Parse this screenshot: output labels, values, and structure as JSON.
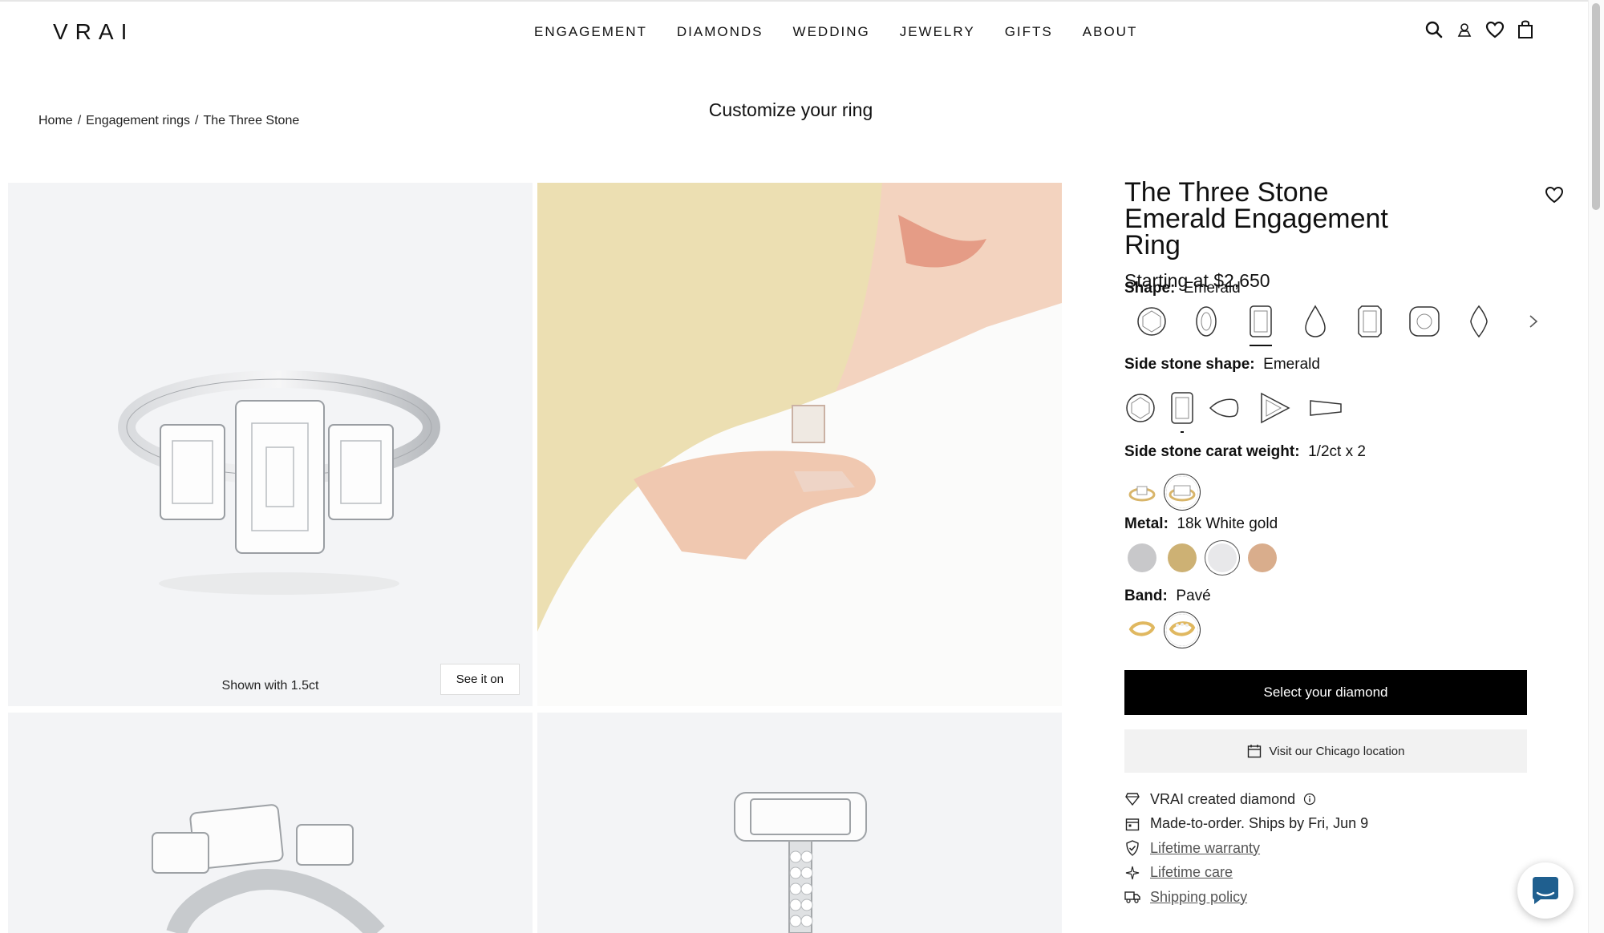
{
  "header": {
    "logo": "VRAI",
    "nav": [
      "ENGAGEMENT",
      "DIAMONDS",
      "WEDDING",
      "JEWELRY",
      "GIFTS",
      "ABOUT"
    ]
  },
  "breadcrumb": [
    "Home",
    "Engagement rings",
    "The Three Stone"
  ],
  "page_heading": "Customize your ring",
  "gallery": {
    "shown_with": "Shown with 1.5ct",
    "see_it_on": "See it on"
  },
  "product": {
    "title": "The Three Stone Emerald Engagement Ring",
    "price": "Starting at $2,650",
    "shape": {
      "label": "Shape:",
      "value": "Emerald",
      "options": [
        "round",
        "oval",
        "emerald",
        "pear",
        "radiant",
        "cushion",
        "marquise"
      ],
      "selected": "emerald"
    },
    "side_stone_shape": {
      "label": "Side stone shape:",
      "value": "Emerald",
      "options": [
        "round",
        "emerald",
        "pear",
        "trillion",
        "tapered-baguette"
      ],
      "selected": "emerald"
    },
    "side_stone_carat": {
      "label": "Side stone carat weight:",
      "value": "1/2ct x 2"
    },
    "metal": {
      "label": "Metal:",
      "value": "18k White gold",
      "colors": [
        "#c8c8ca",
        "#cdb174",
        "#e8e8ea",
        "#d9ad8c"
      ],
      "selected_index": 2
    },
    "band": {
      "label": "Band:",
      "value": "Pavé"
    },
    "cta": "Select your diamond",
    "visit": "Visit our Chicago location",
    "features": [
      {
        "icon": "diamond-icon",
        "text": "VRAI created diamond"
      },
      {
        "icon": "calendar-icon",
        "text": "Made-to-order. Ships by Fri, Jun 9"
      },
      {
        "icon": "shield-check-icon",
        "text": "Lifetime warranty"
      },
      {
        "icon": "sparkle-icon",
        "text": "Lifetime care"
      },
      {
        "icon": "truck-icon",
        "text": "Shipping policy"
      }
    ]
  }
}
